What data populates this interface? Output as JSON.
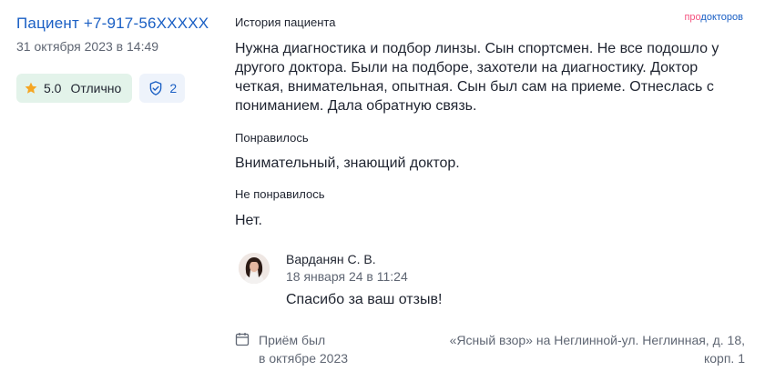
{
  "review": {
    "author": "Пациент +7-917-56XXXXX",
    "date": "31 октября 2023 в 14:49",
    "rating_value": "5.0",
    "rating_label": "Отлично",
    "shield_count": "2"
  },
  "logo": {
    "pro": "про",
    "rest": "докторов"
  },
  "sections": {
    "history_title": "История пациента",
    "history_text": "Нужна диагностика и подбор линзы. Сын спортсмен. Не все подошло у другого доктора. Были на подборе, захотели на диагностику. Доктор четкая, внимательная, опытная. Сын был сам на приеме. Отнеслась с пониманием. Дала обратную связь.",
    "liked_title": "Понравилось",
    "liked_text": "Внимательный, знающий доктор.",
    "disliked_title": "Не понравилось",
    "disliked_text": "Нет."
  },
  "reply": {
    "name": "Варданян С. В.",
    "date": "18 января 24 в 11:24",
    "text": "Спасибо за ваш отзыв!"
  },
  "visit": {
    "line1": "Приём был",
    "line2": "в октябре 2023",
    "clinic": "«Ясный взор» на Неглинной-ул. Неглинная, д. 18, корп. 1"
  },
  "colors": {
    "accent": "#1a5fc4",
    "rating_bg": "#e3f3ea",
    "star": "#f5a623",
    "logo_pro": "#f4527f"
  }
}
